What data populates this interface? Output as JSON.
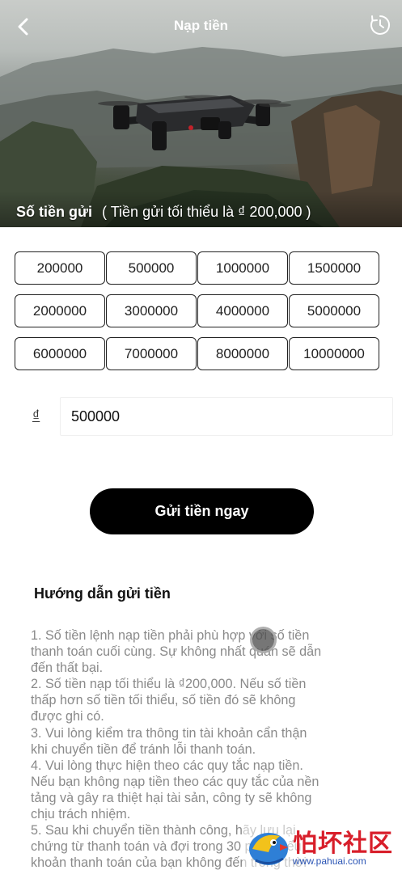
{
  "header": {
    "title": "Nạp tiền",
    "back_icon": "chevron-left-icon",
    "history_icon": "clock-history-icon"
  },
  "deposit": {
    "label": "Số tiền gửi",
    "hint": "( Tiền gửi tối thiểu là ₫ 200,000 )",
    "amounts": [
      "200000",
      "500000",
      "1000000",
      "1500000",
      "2000000",
      "3000000",
      "4000000",
      "5000000",
      "6000000",
      "7000000",
      "8000000",
      "10000000"
    ],
    "currency_symbol": "₫",
    "input_value": "500000",
    "submit_label": "Gửi tiền ngay"
  },
  "guide": {
    "title": "Hướng dẫn gửi tiền",
    "lines": [
      "1. Số tiền lệnh nạp tiền phải phù hợp với số tiền",
      "thanh toán cuối cùng. Sự không nhất quán sẽ dẫn",
      "đến thất bại.",
      "2. Số tiền nạp tối thiểu là ₫200,000. Nếu số tiền",
      "thấp hơn số tiền tối thiểu, số tiền đó sẽ không",
      "được ghi có.",
      "3. Vui lòng kiểm tra thông tin tài khoản cẩn thận",
      "khi chuyển tiền để tránh lỗi thanh toán.",
      "4. Vui lòng thực hiện theo các quy tắc nạp tiền.",
      "Nếu bạn không nạp tiền theo các quy tắc của nền",
      "tảng và gây ra thiệt hại tài sản, công ty sẽ không",
      "chịu trách nhiệm.",
      "5. Sau khi chuyển tiền thành công, hãy lưu lại",
      "chứng từ thanh toán và đợi trong 30 phút. Nếu",
      "khoản thanh toán của bạn không đến trong thời"
    ]
  },
  "watermark": {
    "title": "怕坏社区",
    "url": "www.pahuai.com"
  }
}
